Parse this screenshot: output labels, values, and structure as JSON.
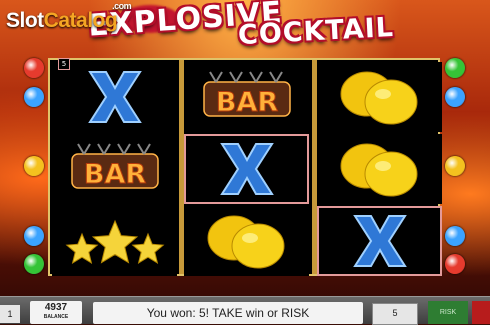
{
  "watermark": {
    "brand_main": "Slot",
    "brand_accent": "Catalog",
    "domain": ".com"
  },
  "game_title": {
    "word1": "EXPLOSIVE",
    "word1_visible": "EXPLOSIVE",
    "word2": "COCKTAIL"
  },
  "payline_number": "5",
  "reels": [
    {
      "symbols": [
        "X",
        "BAR",
        "stars"
      ],
      "win": [
        false,
        false,
        false
      ]
    },
    {
      "symbols": [
        "BAR",
        "X",
        "lemons"
      ],
      "win": [
        false,
        true,
        false
      ]
    },
    {
      "symbols": [
        "lemons",
        "lemons",
        "X"
      ],
      "win": [
        false,
        false,
        true
      ]
    }
  ],
  "symbol_labels": {
    "BAR": "BAR",
    "X": "X"
  },
  "left_fruits": [
    "#e63b2e",
    "#3ba3ff",
    "#f4c21f",
    "#3ba3ff",
    "#35c437"
  ],
  "right_fruits": [
    "#35c437",
    "#3ba3ff",
    "#f4c21f",
    "#3ba3ff",
    "#e63b2e"
  ],
  "bottom_bar": {
    "lines_value": "1",
    "balance_value": "4937",
    "balance_label": "BALANCE",
    "message": "You won: 5! TAKE win or RISK",
    "bet_value": "5",
    "risk_label": "RISK"
  },
  "colors": {
    "accent_gold": "#e0c36a",
    "win_frame": "#e39a9a",
    "title_red": "#b30d2a"
  }
}
